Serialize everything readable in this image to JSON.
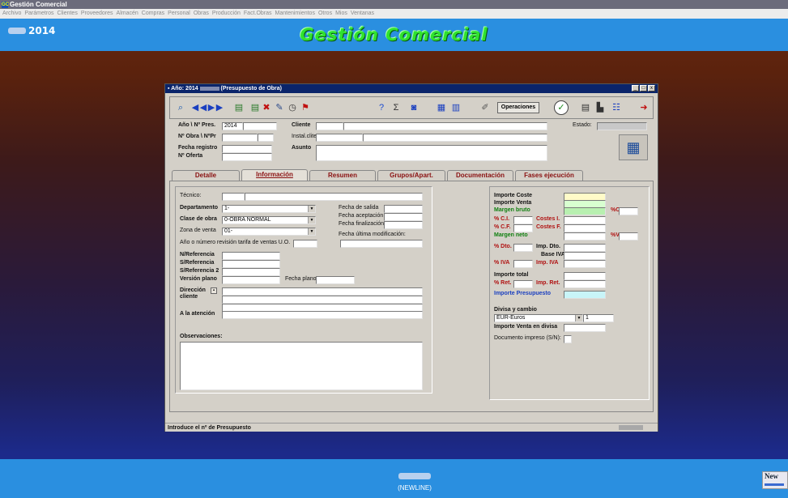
{
  "app": {
    "title": "Gestión Comercial",
    "menu": [
      "Archivo",
      "Parámetros",
      "Clientes",
      "Proveedores",
      "Almacén",
      "Compras",
      "Personal",
      "Obras",
      "Producción",
      "Fact.Obras",
      "Mantenimientos",
      "Otros",
      "Mios",
      "Ventanas"
    ],
    "year_logo": "2014",
    "banner": "Gestión Comercial",
    "footer_user": "(NEWLINE)",
    "new_button": "New"
  },
  "window": {
    "title_prefix": "Año: 2014",
    "title_suffix": "(Presupuesto de Obra)",
    "toolbar": {
      "operations_label": "Operaciones"
    },
    "header": {
      "year_label": "Año \\ Nº Pres.",
      "year_value": "2014",
      "obra_label": "Nº Obra \\ NºPr",
      "fecha_label": "Fecha registro",
      "oferta_label": "Nº Oferta",
      "cliente_label": "Cliente",
      "instal_label": "Instal.clite",
      "asunto_label": "Asunto",
      "estado_label": "Estado:"
    },
    "tabs": [
      "Detalle",
      "Información",
      "Resumen",
      "Grupos/Apart.",
      "Documentación",
      "Fases ejecución"
    ],
    "info": {
      "tecnico": "Técnico:",
      "departamento": "Departamento",
      "departamento_value": "1-",
      "clase_obra": "Clase de obra",
      "clase_obra_value": "0-OBRA NORMAL",
      "zona_venta": "Zona de venta",
      "zona_venta_value": "01-",
      "anio_revision": "Año o número revisión tarifa de ventas U.O.",
      "fecha_salida": "Fecha de salida",
      "fecha_aceptacion": "Fecha aceptación",
      "fecha_finalizacion": "Fecha finalización",
      "fecha_ultima": "Fecha última modificación:",
      "n_referencia": "N/Referencia",
      "s_referencia": "S/Referencia",
      "s_referencia2": "S/Referencia 2",
      "version_plano": "Versión plano",
      "fecha_plano": "Fecha plano",
      "direccion_cliente": "Dirección cliente",
      "a_la_atencion": "A la atención",
      "observaciones": "Observaciones:"
    },
    "totals": {
      "importe_coste": "Importe Coste",
      "importe_venta": "Importe Venta",
      "margen_bruto": "Margen bruto",
      "pct_c": "%C",
      "pct_ci": "% C.I.",
      "costes_i": "Costes I.",
      "pct_cf": "% C.F.",
      "costes_f": "Costes F.",
      "margen_neto": "Margen neto",
      "pct_v": "%V",
      "pct_dto": "% Dto.",
      "imp_dto": "Imp. Dto.",
      "base_iva": "Base IVA",
      "pct_iva": "% IVA",
      "imp_iva": "Imp. IVA",
      "importe_total": "Importe total",
      "pct_ret": "% Ret.",
      "imp_ret": "Imp. Ret.",
      "importe_presupuesto": "Importe Presupuesto",
      "divisa_label": "Divisa y cambio",
      "divisa_value": "EUR-Euros",
      "cambio_value": "1",
      "importe_divisa": "Importe Venta en divisa",
      "documento_impreso": "Documento impreso (S/N):"
    },
    "status_text": "Introduce el nº de Presupuesto"
  },
  "colors": {
    "banner_green": "#2fe22f",
    "header_blue": "#2a8fe0",
    "window_gray": "#d4d0c8",
    "tab_red": "#8a1010"
  }
}
